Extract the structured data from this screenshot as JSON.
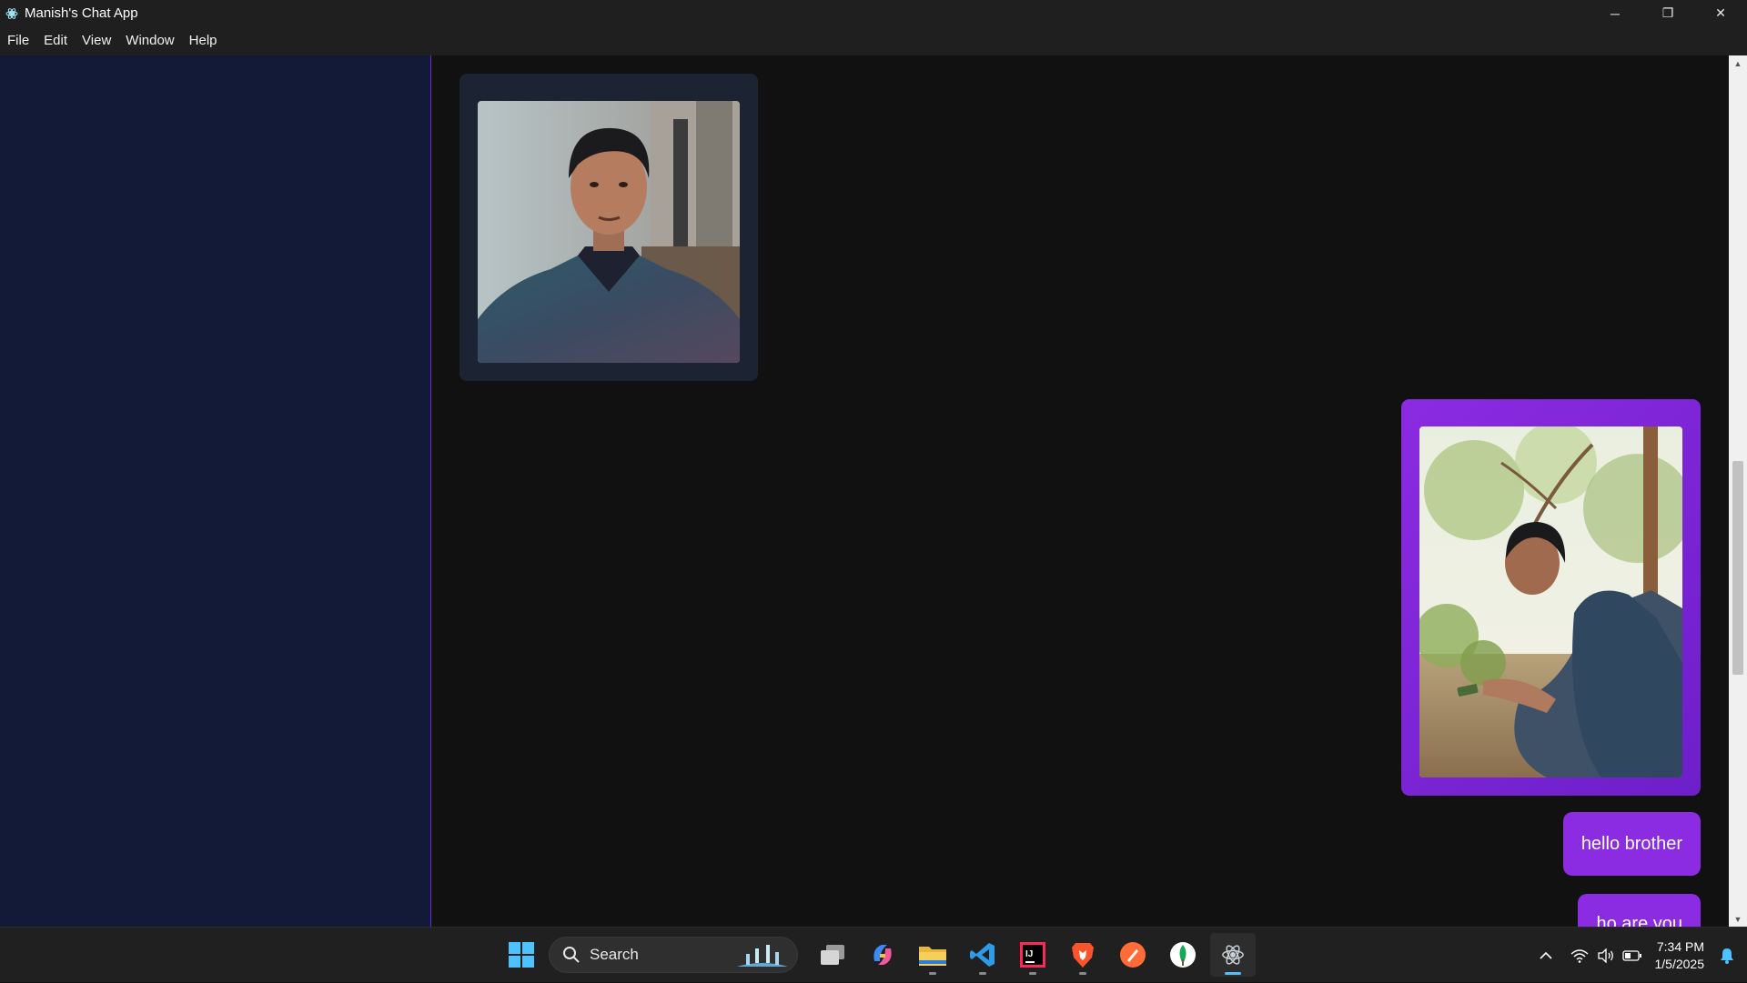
{
  "window": {
    "title": "Manish's Chat App",
    "controls": {
      "minimize": "─",
      "restore": "❐",
      "close": "✕"
    }
  },
  "menu": [
    "File",
    "Edit",
    "View",
    "Window",
    "Help"
  ],
  "chat": {
    "messages": [
      {
        "type": "image",
        "direction": "incoming",
        "alt": "Photo of a young man in a patterned polo shirt"
      },
      {
        "type": "image",
        "direction": "outgoing",
        "alt": "Photo of a young man sitting under a tree looking at his phone"
      },
      {
        "type": "text",
        "direction": "outgoing",
        "text": "hello brother"
      },
      {
        "type": "text",
        "direction": "outgoing",
        "text": "ho are you"
      }
    ]
  },
  "taskbar": {
    "search_label": "Search",
    "apps": [
      "start-icon",
      "task-view-icon",
      "copilot-icon",
      "file-explorer-icon",
      "vscode-icon",
      "intellij-icon",
      "brave-icon",
      "postman-icon",
      "mongodb-icon",
      "electron-app-icon"
    ],
    "clock": {
      "time": "7:34 PM",
      "date": "1/5/2025"
    }
  },
  "colors": {
    "sidebar": "#131a38",
    "chat_bg": "#111111",
    "accent": "#8b2be2",
    "incoming_bubble": "#1c2333"
  }
}
